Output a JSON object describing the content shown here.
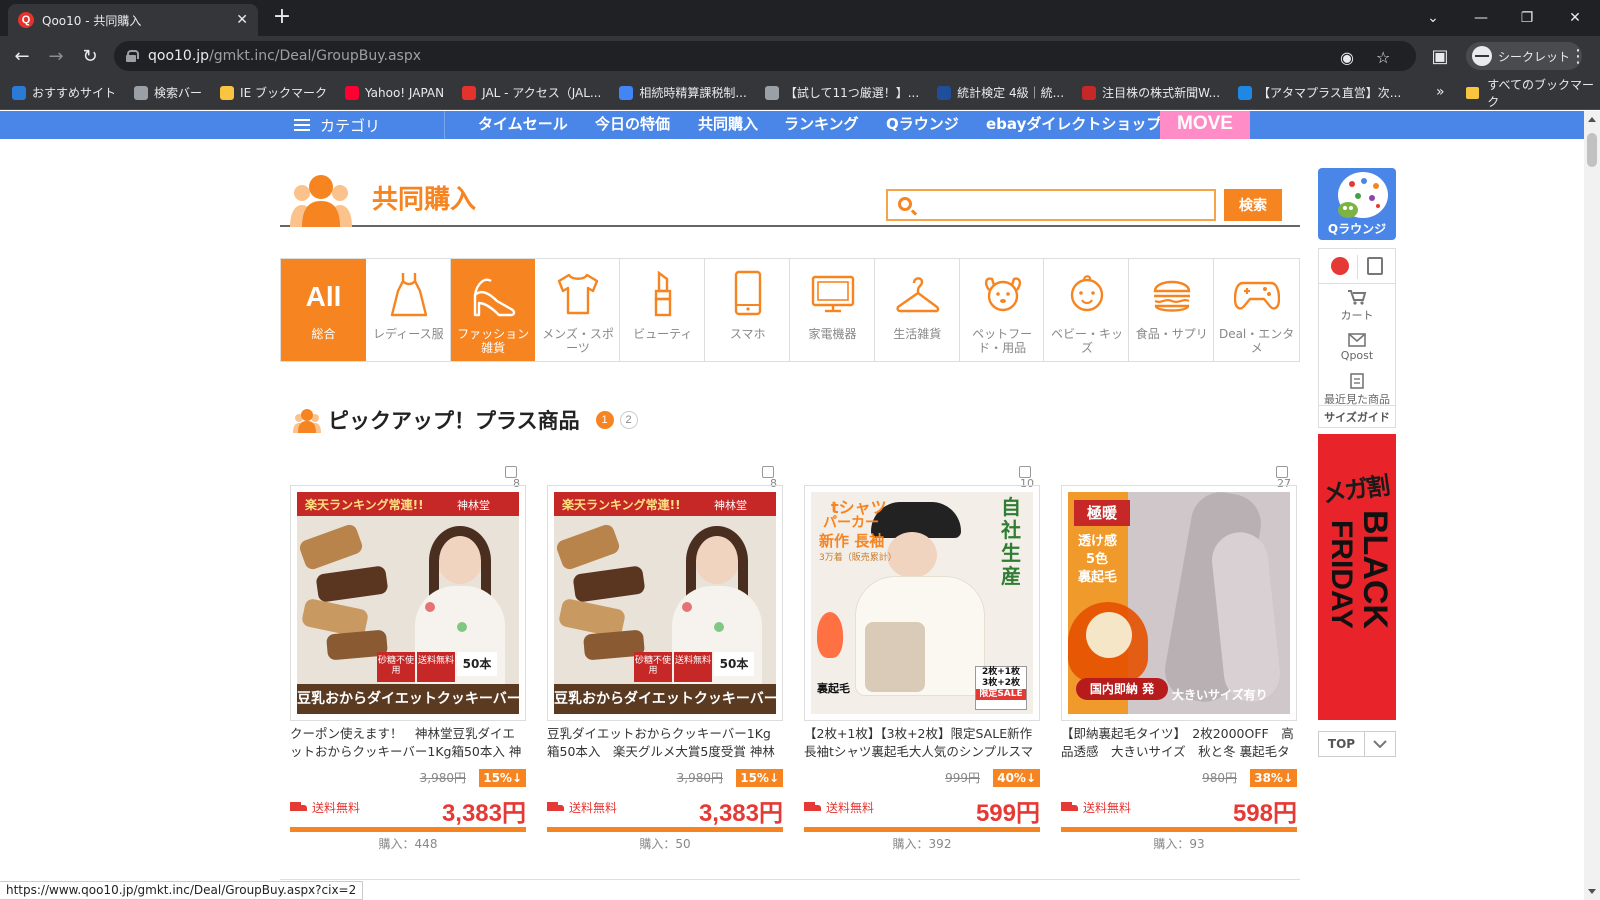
{
  "browser": {
    "tab_title": "Qoo10 - 共同購入",
    "url_host": "qoo10.jp",
    "url_path": "/gmkt.inc/Deal/GroupBuy.aspx",
    "incognito_label": "シークレット",
    "bookmarks": [
      {
        "label": "おすすめサイト",
        "icon": "bing-icon",
        "color": "#2b7bd6"
      },
      {
        "label": "検索バー",
        "icon": "globe-icon",
        "color": "#9aa0a6"
      },
      {
        "label": "IE ブックマーク",
        "icon": "folder-icon",
        "color": "#f9c440"
      },
      {
        "label": "Yahoo! JAPAN",
        "icon": "yahoo-icon",
        "color": "#ff0033"
      },
      {
        "label": "JAL - アクセス（JAL...",
        "icon": "jal-icon",
        "color": "#e5322d"
      },
      {
        "label": "相続時精算課税制...",
        "icon": "google-icon",
        "color": "#4285f4"
      },
      {
        "label": "【試して11つ厳選！】...",
        "icon": "globe-icon",
        "color": "#9aa0a6"
      },
      {
        "label": "統計検定 4級｜統...",
        "icon": "jss-icon",
        "color": "#1f4e9a"
      },
      {
        "label": "注目株の株式新聞W...",
        "icon": "kabu-icon",
        "color": "#c62828"
      },
      {
        "label": "【アタマプラス直営】次...",
        "icon": "t-icon",
        "color": "#1e88e5"
      }
    ],
    "more_label": "»",
    "all_bookmarks_label": "すべてのブックマーク",
    "status_url": "https://www.qoo10.jp/gmkt.inc/Deal/GroupBuy.aspx?cix=2"
  },
  "gnav": {
    "category_label": "カテゴリ",
    "links": [
      "タイムセール",
      "今日の特価",
      "共同購入",
      "ランキング",
      "Qラウンジ",
      "ebayダイレクトショップ"
    ],
    "move_label": "MOVE"
  },
  "header": {
    "title": "共同購入",
    "search_placeholder": "",
    "search_button": "検索"
  },
  "categories": [
    {
      "label": "総合",
      "big": "All",
      "icon": "all-icon",
      "active": true
    },
    {
      "label": "レディース服",
      "icon": "dress-icon",
      "active": false
    },
    {
      "label": "ファッション雑貨",
      "icon": "heel-icon",
      "active": true
    },
    {
      "label": "メンズ・スポーツ",
      "icon": "tshirt-icon",
      "active": false
    },
    {
      "label": "ビューティ",
      "icon": "lipstick-icon",
      "active": false
    },
    {
      "label": "スマホ",
      "icon": "smartphone-icon",
      "active": false
    },
    {
      "label": "家電機器",
      "icon": "monitor-icon",
      "active": false
    },
    {
      "label": "生活雑貨",
      "icon": "hanger-icon",
      "active": false
    },
    {
      "label": "ペットフード・用品",
      "icon": "dog-icon",
      "active": false
    },
    {
      "label": "ベビー・キッズ",
      "icon": "baby-icon",
      "active": false
    },
    {
      "label": "食品・サプリ",
      "icon": "burger-icon",
      "active": false
    },
    {
      "label": "Deal・エンタメ",
      "icon": "gamepad-icon",
      "active": false
    }
  ],
  "pickup": {
    "title": "ピックアップ！プラス商品",
    "pages": [
      "1",
      "2"
    ],
    "current_page": "1"
  },
  "products": [
    {
      "count": "8",
      "name": "クーポン使えます！　神林堂豆乳ダイエットおからクッキーバー1Kg箱50本入 神",
      "orig_price": "3,980円",
      "discount": "15%↓",
      "shipping": "送料無料",
      "price": "3,383円",
      "purchases": "購入：448",
      "image_texts": [
        "楽天ランキング常連!!",
        "神林堂",
        "砂糖不使用",
        "送料無料",
        "50本",
        "豆乳おからダイエットクッキーバー"
      ]
    },
    {
      "count": "8",
      "name": "豆乳ダイエットおからクッキーバー1Kg箱50本入　楽天グルメ大賞5度受賞 神林",
      "orig_price": "3,980円",
      "discount": "15%↓",
      "shipping": "送料無料",
      "price": "3,383円",
      "purchases": "購入：50",
      "image_texts": [
        "楽天ランキング常連!!",
        "神林堂",
        "砂糖不使用",
        "送料無料",
        "50本",
        "豆乳おからダイエットクッキーバー"
      ]
    },
    {
      "count": "10",
      "name": "【2枚+1枚】【3枚+2枚】限定SALE新作長袖tシャツ裏起毛大人気のシンプルスマ",
      "orig_price": "999円",
      "discount": "40%↓",
      "shipping": "送料無料",
      "price": "599円",
      "purchases": "購入：392",
      "image_texts": [
        "tシャツ",
        "パーカー",
        "新作 長袖",
        "3万着（販売累計）",
        "自社生産",
        "裏起毛",
        "2枚+1枚",
        "3枚+2枚",
        "限定SALE"
      ]
    },
    {
      "count": "27",
      "name": "【即納裏起毛タイツ】　2枚2000OFF　高品透感　大きいサイズ　秋と冬 裏起毛タ",
      "orig_price": "980円",
      "discount": "38%↓",
      "shipping": "送料無料",
      "price": "598円",
      "purchases": "購入：93",
      "image_texts": [
        "極暖",
        "透け感",
        "5色",
        "裏起毛",
        "国内即納",
        "発",
        "大きいサイズ有り"
      ]
    }
  ],
  "sidebar": {
    "qlounge_label": "Qラウンジ",
    "cart_label": "カート",
    "qpost_label": "Qpost",
    "recent_label": "最近見た商品",
    "size_guide_label": "サイズガイド",
    "banner_texts": [
      "メガ割",
      "BLACK",
      "FRIDAY"
    ],
    "top_label": "TOP"
  }
}
